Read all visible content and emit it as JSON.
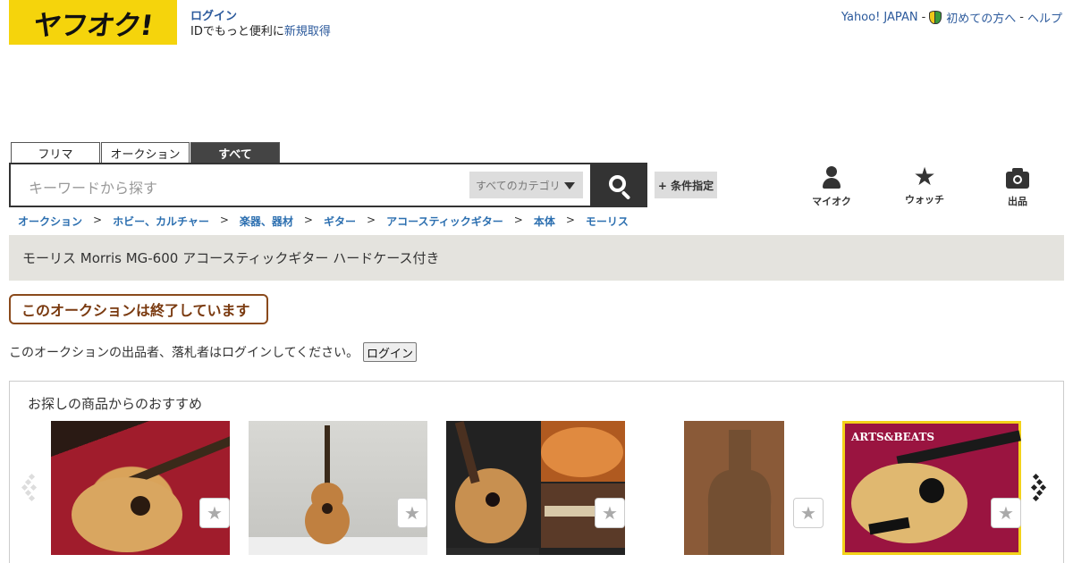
{
  "header": {
    "logo": "ヤフオク!",
    "login_link": "ログイン",
    "login_line2_prefix": "IDでもっと便利に",
    "signup_link": "新規取得",
    "top_links": {
      "yahoo": "Yahoo! JAPAN",
      "beginner": "初めての方へ",
      "help": "ヘルプ",
      "separator": "-"
    }
  },
  "search": {
    "tabs": [
      "フリマ",
      "オークション",
      "すべて"
    ],
    "active_tab": "すべて",
    "placeholder": "キーワードから探す",
    "category": "すべてのカテゴリ",
    "condition_button": "+ 条件指定"
  },
  "nav_icons": [
    {
      "label": "マイオク",
      "icon": "person-icon"
    },
    {
      "label": "ウォッチ",
      "icon": "star-icon"
    },
    {
      "label": "出品",
      "icon": "camera-icon"
    }
  ],
  "breadcrumb": {
    "items": [
      "オークション",
      "ホビー、カルチャー",
      "楽器、器材",
      "ギター",
      "アコースティックギター",
      "本体",
      "モーリス"
    ],
    "arrow": ">"
  },
  "item": {
    "title": "モーリス Morris MG-600 アコースティックギター ハードケース付き",
    "ended_text": "このオークションは終了しています",
    "notice": "このオークションの出品者、落札者はログインしてください。",
    "notice_button": "ログイン"
  },
  "recommend": {
    "title": "お探しの商品からのおすすめ",
    "items": [
      {
        "image_label": "guitar-in-case-red"
      },
      {
        "image_label": "guitar-against-wall"
      },
      {
        "image_label": "guitar-collage"
      },
      {
        "image_label": "guitar-case-wood"
      },
      {
        "image_label": "guitar-on-red-cloth",
        "overlay_text": "ARTS&BEATS"
      }
    ]
  },
  "colors": {
    "logo_bg": "#f5d40c",
    "link": "#2c5a9c",
    "ended_border": "#8a4a1c",
    "title_bg": "#e4e3de"
  }
}
